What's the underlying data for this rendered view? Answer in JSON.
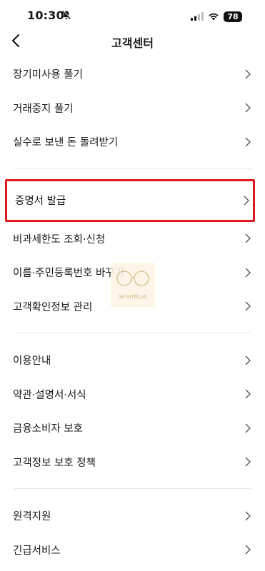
{
  "status": {
    "time": "10:30",
    "battery": "78",
    "icons": [
      "bell-slash-icon",
      "signal-icon",
      "wifi-icon",
      "battery-icon"
    ]
  },
  "nav": {
    "title": "고객센터",
    "back_icon": "chevron-left-icon"
  },
  "groups": [
    {
      "items": [
        {
          "label": "장기미사용 풀기"
        },
        {
          "label": "거래중지 풀기"
        },
        {
          "label": "실수로 보낸 돈 돌려받기"
        }
      ]
    },
    {
      "items": [
        {
          "label": "증명서 발급",
          "highlighted": true
        },
        {
          "label": "비과세한도 조회·신청"
        },
        {
          "label": "이름·주민등록번호 바꾸기"
        },
        {
          "label": "고객확인정보 관리"
        }
      ]
    },
    {
      "items": [
        {
          "label": "이용안내"
        },
        {
          "label": "약관·설명서·서식"
        },
        {
          "label": "금융소비자 보호"
        },
        {
          "label": "고객정보 보호 정책"
        }
      ]
    },
    {
      "items": [
        {
          "label": "원격지원"
        },
        {
          "label": "긴급서비스"
        }
      ]
    }
  ],
  "watermark": {
    "text": "SmartMLab"
  },
  "colors": {
    "highlight": "#e0191e",
    "divider": "#e6e6e6",
    "chevron": "#555555"
  }
}
